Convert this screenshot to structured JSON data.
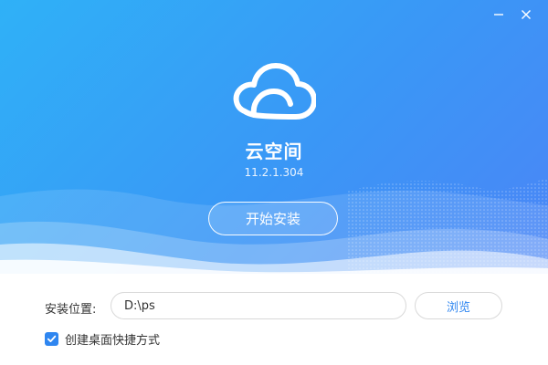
{
  "window": {
    "minimize_icon": "minimize-icon",
    "close_icon": "close-icon"
  },
  "app": {
    "logo_icon": "cloud-logo-icon",
    "name": "云空间",
    "version": "11.2.1.304"
  },
  "actions": {
    "install_label": "开始安装"
  },
  "install_path": {
    "label": "安装位置:",
    "value": "D:\\ps",
    "browse_label": "浏览"
  },
  "options": {
    "create_shortcut_label": "创建桌面快捷方式",
    "create_shortcut_checked": true
  },
  "colors": {
    "accent": "#2f86f0",
    "hero_start": "#2fb1f7",
    "hero_end": "#4b85f6"
  }
}
